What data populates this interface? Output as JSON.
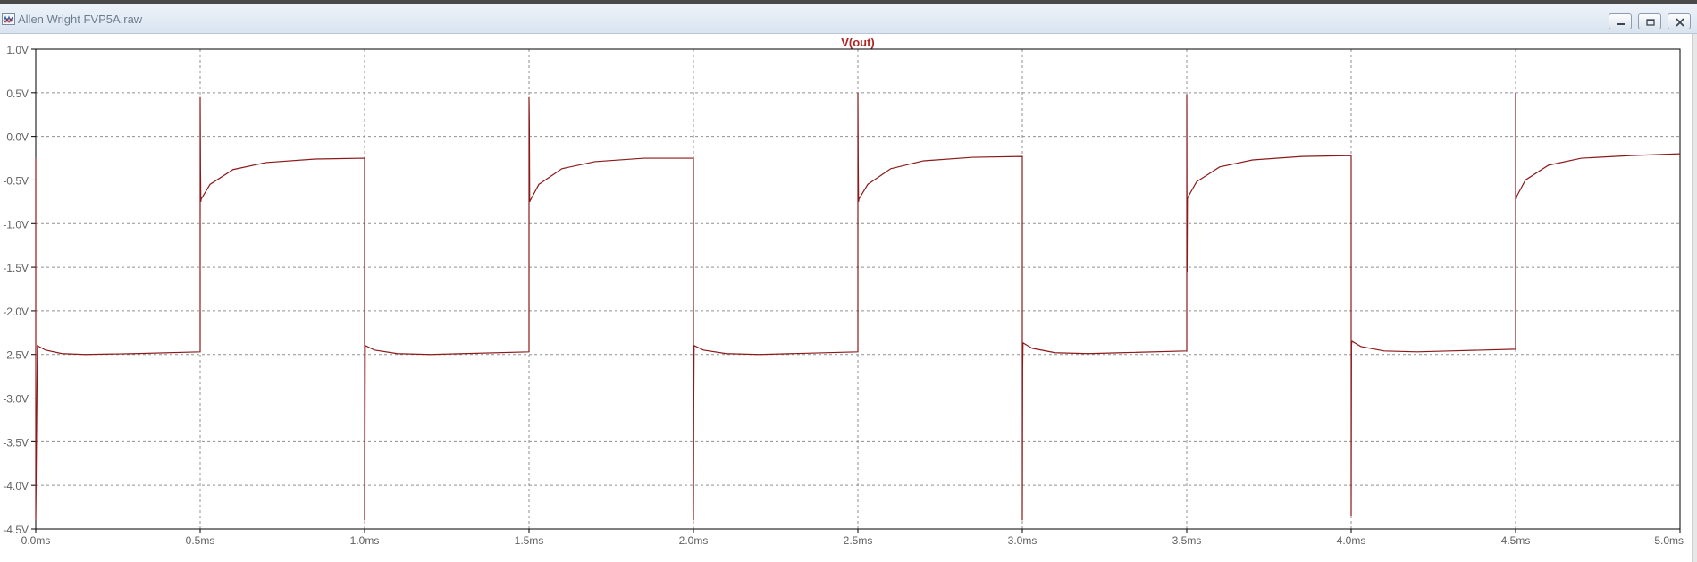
{
  "window": {
    "title": "Allen Wright FVP5A.raw",
    "icon": "waveform-icon",
    "buttons": {
      "minimize": "minimize-icon",
      "maximize": "maximize-icon",
      "close": "close-icon"
    }
  },
  "colors": {
    "trace": "#8b1a1a",
    "title_text": "#b22222",
    "axis_text": "#606060",
    "grid": "#909090"
  },
  "chart_data": {
    "type": "line",
    "title": "V(out)",
    "xlabel": "",
    "ylabel": "",
    "xlim": [
      0,
      5
    ],
    "ylim": [
      -4.5,
      1.0
    ],
    "grid": true,
    "x_ticks": [
      "0.0ms",
      "0.5ms",
      "1.0ms",
      "1.5ms",
      "2.0ms",
      "2.5ms",
      "3.0ms",
      "3.5ms",
      "4.0ms",
      "4.5ms",
      "5.0ms"
    ],
    "x_tick_values": [
      0,
      0.5,
      1.0,
      1.5,
      2.0,
      2.5,
      3.0,
      3.5,
      4.0,
      4.5,
      5.0
    ],
    "y_ticks": [
      "1.0V",
      "0.5V",
      "0.0V",
      "-0.5V",
      "-1.0V",
      "-1.5V",
      "-2.0V",
      "-2.5V",
      "-3.0V",
      "-3.5V",
      "-4.0V",
      "-4.5V"
    ],
    "y_tick_values": [
      1.0,
      0.5,
      0.0,
      -0.5,
      -1.0,
      -1.5,
      -2.0,
      -2.5,
      -3.0,
      -3.5,
      -4.0,
      -4.5
    ],
    "series": [
      {
        "name": "V(out)",
        "x": [
          0,
          0,
          0.005,
          0.03,
          0.08,
          0.15,
          0.3,
          0.499,
          0.5,
          0.5,
          0.501,
          0.502,
          0.503,
          0.53,
          0.6,
          0.7,
          0.85,
          0.999,
          1.0,
          1.0,
          1.001,
          1.002,
          1.003,
          1.03,
          1.1,
          1.2,
          1.3,
          1.499,
          1.5,
          1.5,
          1.501,
          1.502,
          1.503,
          1.53,
          1.6,
          1.7,
          1.85,
          1.999,
          2.0,
          2.0,
          2.001,
          2.002,
          2.003,
          2.03,
          2.1,
          2.2,
          2.3,
          2.499,
          2.5,
          2.5,
          2.501,
          2.502,
          2.503,
          2.53,
          2.6,
          2.7,
          2.85,
          2.999,
          3.0,
          3.0,
          3.001,
          3.002,
          3.003,
          3.03,
          3.1,
          3.2,
          3.3,
          3.499,
          3.5,
          3.5,
          3.501,
          3.502,
          3.503,
          3.53,
          3.6,
          3.7,
          3.85,
          3.999,
          4.0,
          4.0,
          4.001,
          4.002,
          4.003,
          4.03,
          4.1,
          4.2,
          4.3,
          4.499,
          4.5,
          4.5,
          4.501,
          4.502,
          4.503,
          4.53,
          4.6,
          4.7,
          4.85,
          5.0
        ],
        "y": [
          -0.25,
          -4.4,
          -2.4,
          -2.45,
          -2.49,
          -2.5,
          -2.49,
          -2.47,
          -2.47,
          0.45,
          -0.4,
          -0.75,
          -0.72,
          -0.55,
          -0.38,
          -0.3,
          -0.26,
          -0.25,
          -0.25,
          -4.4,
          -3.7,
          -2.4,
          -2.4,
          -2.45,
          -2.49,
          -2.5,
          -2.49,
          -2.47,
          -2.47,
          0.45,
          0.15,
          -0.75,
          -0.74,
          -0.55,
          -0.37,
          -0.29,
          -0.25,
          -0.25,
          -0.25,
          -4.4,
          -3.05,
          -2.4,
          -2.4,
          -2.45,
          -2.49,
          -2.5,
          -2.49,
          -2.47,
          -2.47,
          0.5,
          -0.3,
          -0.75,
          -0.72,
          -0.55,
          -0.37,
          -0.28,
          -0.24,
          -0.23,
          -0.23,
          -4.4,
          -2.65,
          -2.38,
          -2.37,
          -2.43,
          -2.48,
          -2.49,
          -2.48,
          -2.46,
          -2.46,
          0.48,
          -1.55,
          -0.72,
          -0.7,
          -0.52,
          -0.35,
          -0.27,
          -0.23,
          -0.22,
          -0.22,
          -4.35,
          -2.4,
          -2.35,
          -2.35,
          -2.41,
          -2.46,
          -2.47,
          -2.46,
          -2.44,
          -2.44,
          0.5,
          -0.7,
          -0.72,
          -0.69,
          -0.5,
          -0.33,
          -0.25,
          -0.22,
          -0.2
        ]
      }
    ]
  }
}
